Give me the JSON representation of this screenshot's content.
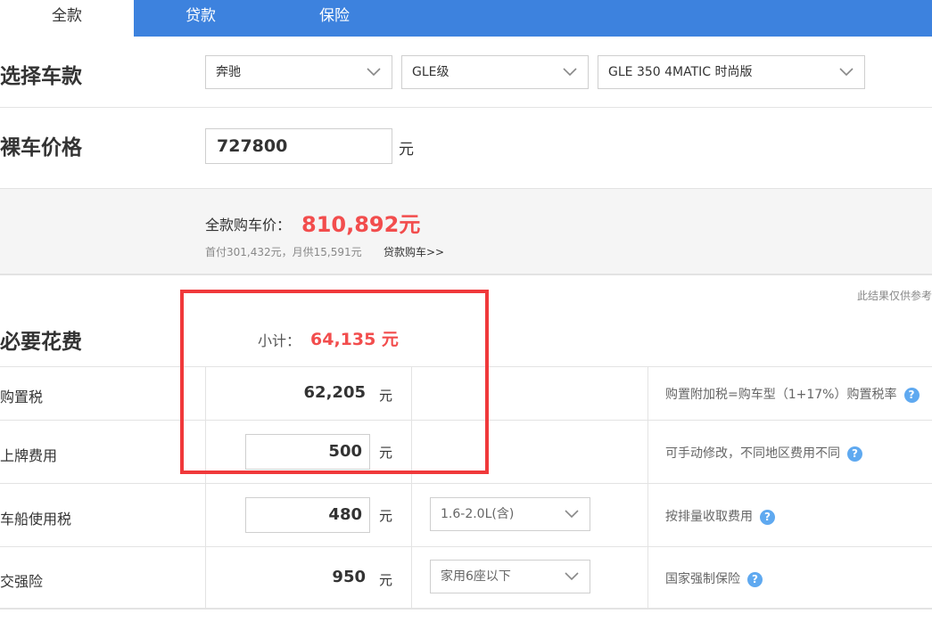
{
  "tabs": [
    {
      "label": "全款",
      "active": true
    },
    {
      "label": "贷款",
      "active": false
    },
    {
      "label": "保险",
      "active": false
    }
  ],
  "select_car": {
    "title": "选择车款",
    "brand": "奔驰",
    "series": "GLE级",
    "model": "GLE 350 4MATIC 时尚版"
  },
  "bare_price": {
    "title": "裸车价格",
    "value": "727800",
    "unit": "元"
  },
  "summary": {
    "total_label": "全款购车价：",
    "total_value": "810,892元",
    "sub_text": "首付301,432元，月供15,591元",
    "loan_link": "贷款购车>>"
  },
  "note": "此结果仅供参考",
  "required": {
    "title": "必要花费",
    "subtotal_label": "小计：",
    "subtotal_value": "64,135 元",
    "rows": [
      {
        "label": "购置税",
        "value": "62,205",
        "unit": "元",
        "desc": "购置附加税=购车型（1+17%）购置税率"
      },
      {
        "label": "上牌费用",
        "value": "500",
        "unit": "元",
        "desc": "可手动修改，不同地区费用不同"
      },
      {
        "label": "车船使用税",
        "value": "480",
        "unit": "元",
        "option": "1.6-2.0L(含)",
        "desc": "按排量收取费用"
      },
      {
        "label": "交强险",
        "value": "950",
        "unit": "元",
        "option": "家用6座以下",
        "desc": "国家强制保险"
      }
    ]
  },
  "icons": {
    "help": "?"
  },
  "colors": {
    "tab_bar": "#3d82de",
    "accent_red": "#f24d4d",
    "highlight": "#f0393b",
    "help_icon": "#5fa9f0"
  }
}
